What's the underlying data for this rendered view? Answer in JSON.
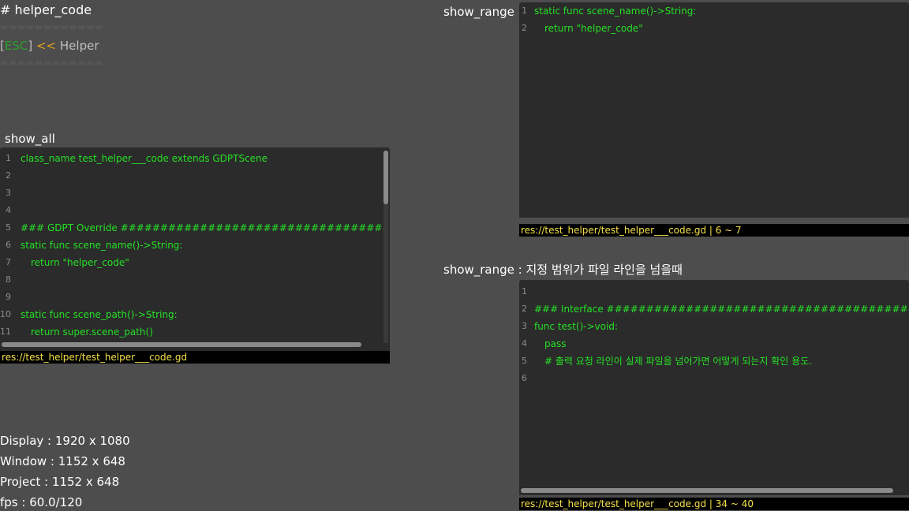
{
  "header": {
    "title": "# helper_code",
    "separator": "============",
    "breadcrumb": {
      "bracket_open": "[",
      "esc": "ESC",
      "bracket_close": "]",
      "arrow": "<<",
      "label": "Helper"
    }
  },
  "show_all": {
    "label": "show_all",
    "file": "res://test_helper/test_helper___code.gd",
    "lines": [
      {
        "n": "1",
        "text": "class_name test_helper___code extends GDPTScene",
        "indent": 0
      },
      {
        "n": "2",
        "text": "",
        "indent": 0
      },
      {
        "n": "3",
        "text": "",
        "indent": 0
      },
      {
        "n": "4",
        "text": "",
        "indent": 0
      },
      {
        "n": "5",
        "text": "### GDPT Override ##############################################",
        "indent": 0
      },
      {
        "n": "6",
        "text": "static func scene_name()->String:",
        "indent": 0
      },
      {
        "n": "7",
        "text": "return \"helper_code\"",
        "indent": 1
      },
      {
        "n": "8",
        "text": "",
        "indent": 0
      },
      {
        "n": "9",
        "text": "",
        "indent": 0
      },
      {
        "n": "10",
        "text": "static func scene_path()->String:",
        "indent": 0
      },
      {
        "n": "11",
        "text": "return super.scene_path()",
        "indent": 1
      }
    ]
  },
  "show_range_1": {
    "label": "show_range",
    "footer": "res://test_helper/test_helper___code.gd | 6 ~ 7",
    "lines": [
      {
        "n": "1",
        "text": "static func scene_name()->String:",
        "indent": 0
      },
      {
        "n": "2",
        "text": "return \"helper_code\"",
        "indent": 1
      }
    ]
  },
  "show_range_2": {
    "label": "show_range : 지정 범위가 파일 라인을 넘을때",
    "footer": "res://test_helper/test_helper___code.gd | 34 ~ 40",
    "lines": [
      {
        "n": "1",
        "text": "",
        "indent": 0
      },
      {
        "n": "2",
        "text": "### Interface #####################################################",
        "indent": 0
      },
      {
        "n": "3",
        "text": "func test()->void:",
        "indent": 0
      },
      {
        "n": "4",
        "text": "pass",
        "indent": 1
      },
      {
        "n": "5",
        "text": "# 출력 요청 라인이 실제 파일을 넘어가면 어떻게 되는지 확인 용도.",
        "indent": 1
      },
      {
        "n": "6",
        "text": "",
        "indent": 0
      }
    ]
  },
  "stats": {
    "display": "Display : 1920 x 1080",
    "window": "Window : 1152 x 648",
    "project": "Project : 1152 x 648",
    "fps": "fps : 60.0/120"
  },
  "colors": {
    "background": "#4d4d4d",
    "panel": "#2b2b2b",
    "code_text": "#25e025",
    "line_number": "#8c8c8c",
    "footer_text": "#f5e14a",
    "esc": "#2aa12a",
    "arrow": "#e0a020"
  }
}
